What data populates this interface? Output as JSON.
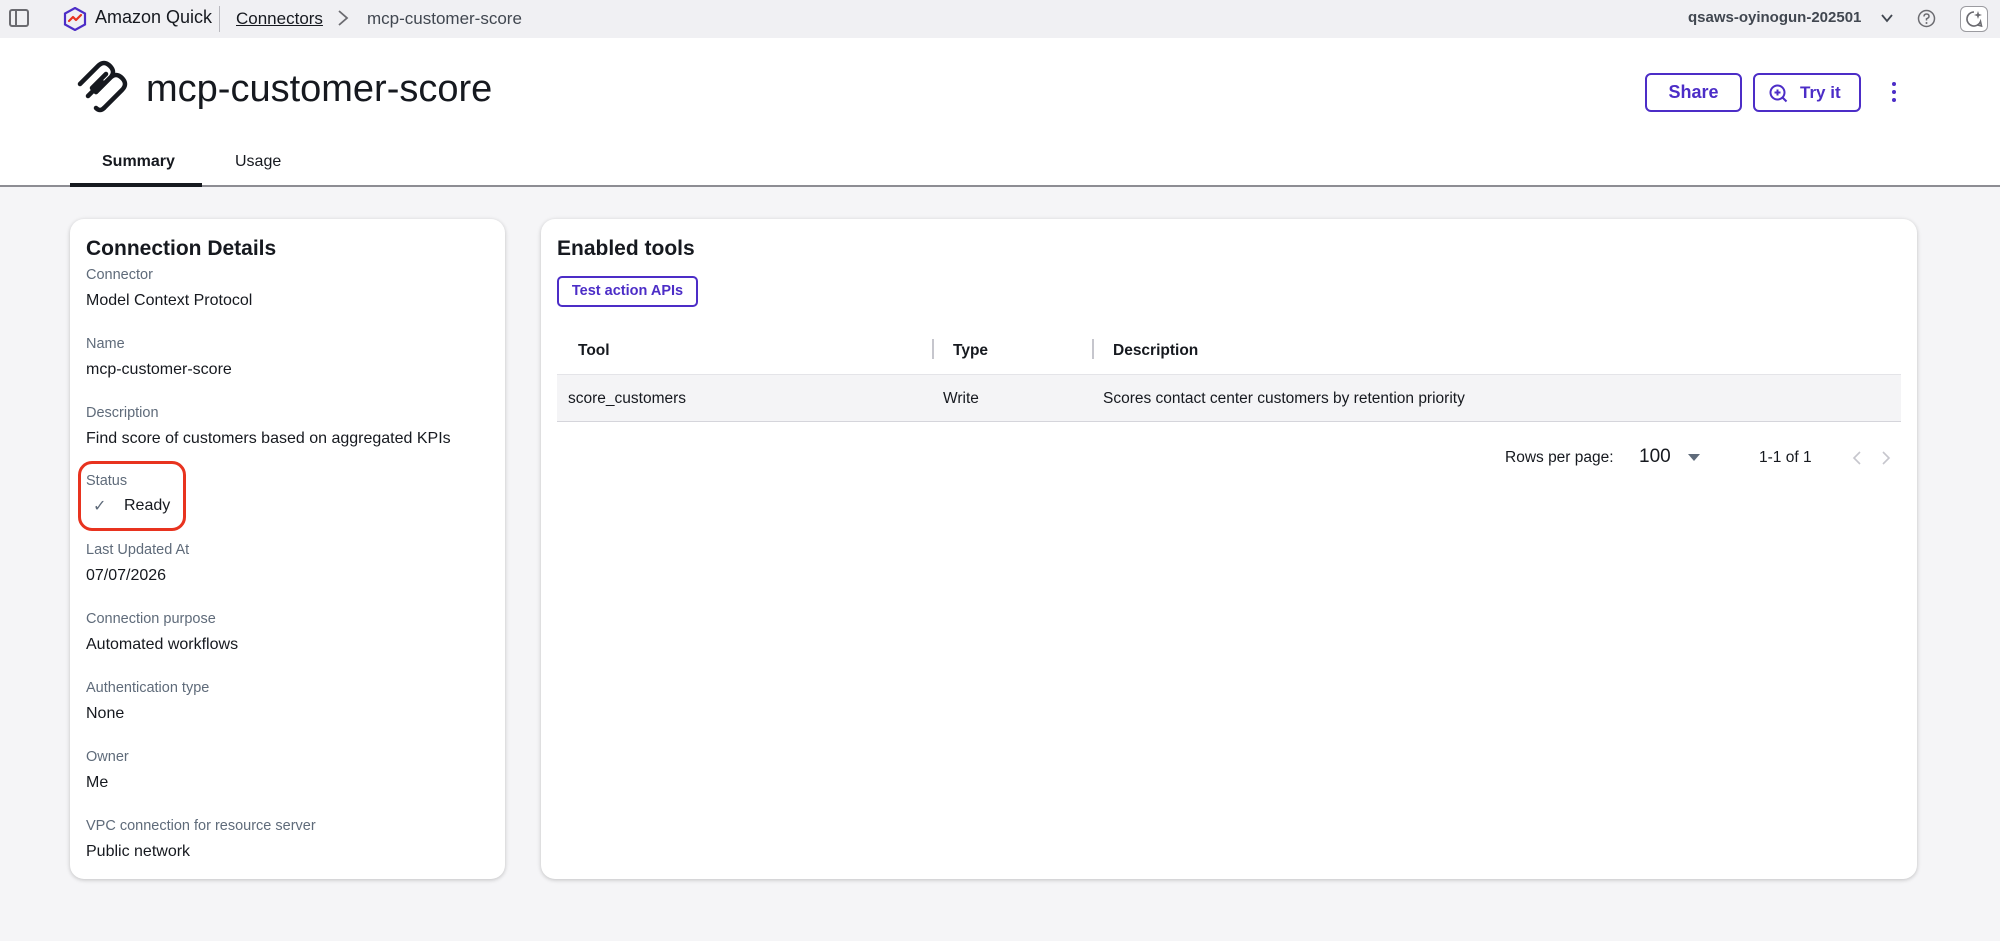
{
  "topbar": {
    "app_name": "Amazon Quick",
    "breadcrumb": {
      "parent": "Connectors",
      "current": "mcp-customer-score"
    },
    "account": "qsaws-oyinogun-202501"
  },
  "header": {
    "title": "mcp-customer-score",
    "share_label": "Share",
    "try_label": "Try it",
    "tabs": [
      {
        "label": "Summary",
        "active": true
      },
      {
        "label": "Usage",
        "active": false
      }
    ]
  },
  "connection_details": {
    "title": "Connection Details",
    "fields": [
      {
        "label": "Connector",
        "value": "Model Context Protocol"
      },
      {
        "label": "Name",
        "value": "mcp-customer-score"
      },
      {
        "label": "Description",
        "value": "Find score of customers based on aggregated KPIs"
      },
      {
        "label": "Status",
        "value": "Ready"
      },
      {
        "label": "Last Updated At",
        "value": "07/07/2026"
      },
      {
        "label": "Connection purpose",
        "value": "Automated workflows"
      },
      {
        "label": "Authentication type",
        "value": "None"
      },
      {
        "label": "Owner",
        "value": "Me"
      },
      {
        "label": "VPC connection for resource server",
        "value": "Public network"
      }
    ]
  },
  "enabled_tools": {
    "title": "Enabled tools",
    "test_button_label": "Test action APIs",
    "columns": [
      "Tool",
      "Type",
      "Description"
    ],
    "rows": [
      {
        "tool": "score_customers",
        "type": "Write",
        "description": "Scores contact center customers by retention priority"
      }
    ],
    "pagination": {
      "rows_per_page_label": "Rows per page:",
      "rows_per_page": "100",
      "range": "1-1 of 1"
    }
  },
  "colors": {
    "accent": "#4c2dc7",
    "highlight_ring": "#e8331f",
    "text": "#16191f",
    "muted": "#5f6b7a"
  }
}
